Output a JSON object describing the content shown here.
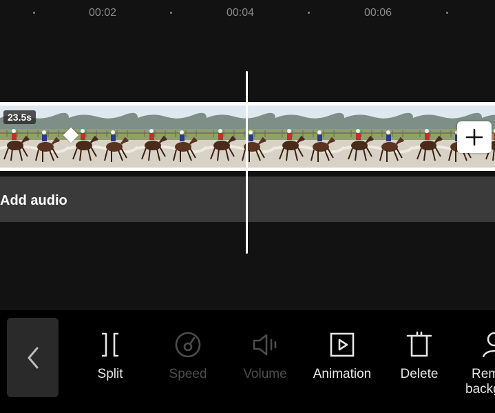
{
  "ruler": {
    "labels": [
      "00:02",
      "00:04",
      "00:06"
    ]
  },
  "video_track": {
    "duration": "23.5s",
    "frame_count": 8
  },
  "audio_track": {
    "label": "Add audio"
  },
  "toolbar": {
    "tools": [
      {
        "label": "Split",
        "icon": "split-icon",
        "enabled": true
      },
      {
        "label": "Speed",
        "icon": "speed-icon",
        "enabled": false
      },
      {
        "label": "Volume",
        "icon": "volume-icon",
        "enabled": false
      },
      {
        "label": "Animation",
        "icon": "animation-icon",
        "enabled": true
      },
      {
        "label": "Delete",
        "icon": "delete-icon",
        "enabled": true
      },
      {
        "label_line1": "Rem",
        "label_line2": "backg",
        "icon": "remove-background-icon",
        "enabled": true
      }
    ]
  },
  "colors": {
    "background": "#121212",
    "audio_track": "#3a3a3a",
    "toolbar": "#000000",
    "disabled_text": "#4d4d4d"
  }
}
